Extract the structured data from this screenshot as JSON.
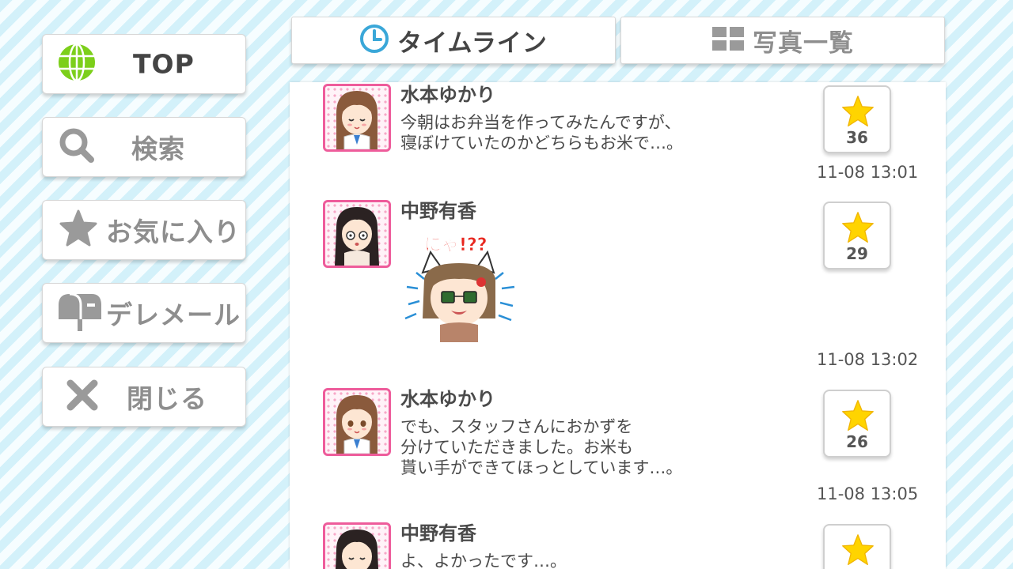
{
  "sidebar": {
    "items": [
      {
        "label": "TOP",
        "icon": "globe-icon"
      },
      {
        "label": "検索",
        "icon": "search-icon"
      },
      {
        "label": "お気に入り",
        "icon": "star-icon"
      },
      {
        "label": "デレメール",
        "icon": "mailbox-icon"
      },
      {
        "label": "閉じる",
        "icon": "close-icon"
      }
    ]
  },
  "tabs": [
    {
      "label": "タイムライン",
      "icon": "clock-icon",
      "active": true
    },
    {
      "label": "写真一覧",
      "icon": "grid-icon",
      "active": false
    }
  ],
  "posts": [
    {
      "name": "水本ゆかり",
      "lines": [
        "今朝はお弁当を作ってみたんですが、",
        "寝ぼけていたのかどちらもお米で…。"
      ],
      "likes": "36",
      "time": "11-08 13:01"
    },
    {
      "name": "中野有香",
      "sticker_text": "にゃ!??",
      "likes": "29",
      "time": "11-08 13:02"
    },
    {
      "name": "水本ゆかり",
      "lines": [
        "でも、スタッフさんにおかずを",
        "分けていただきました。お米も",
        "貰い手ができてほっとしています…。"
      ],
      "likes": "26",
      "time": "11-08 13:05"
    },
    {
      "name": "中野有香",
      "lines": [
        "よ、よかったです…。"
      ],
      "likes": "",
      "time": ""
    }
  ],
  "colors": {
    "accent_pink": "#ee5c9b",
    "star_yellow": "#ffd400",
    "clock_blue": "#3aa7d8",
    "globe_green": "#7ccf1a"
  }
}
